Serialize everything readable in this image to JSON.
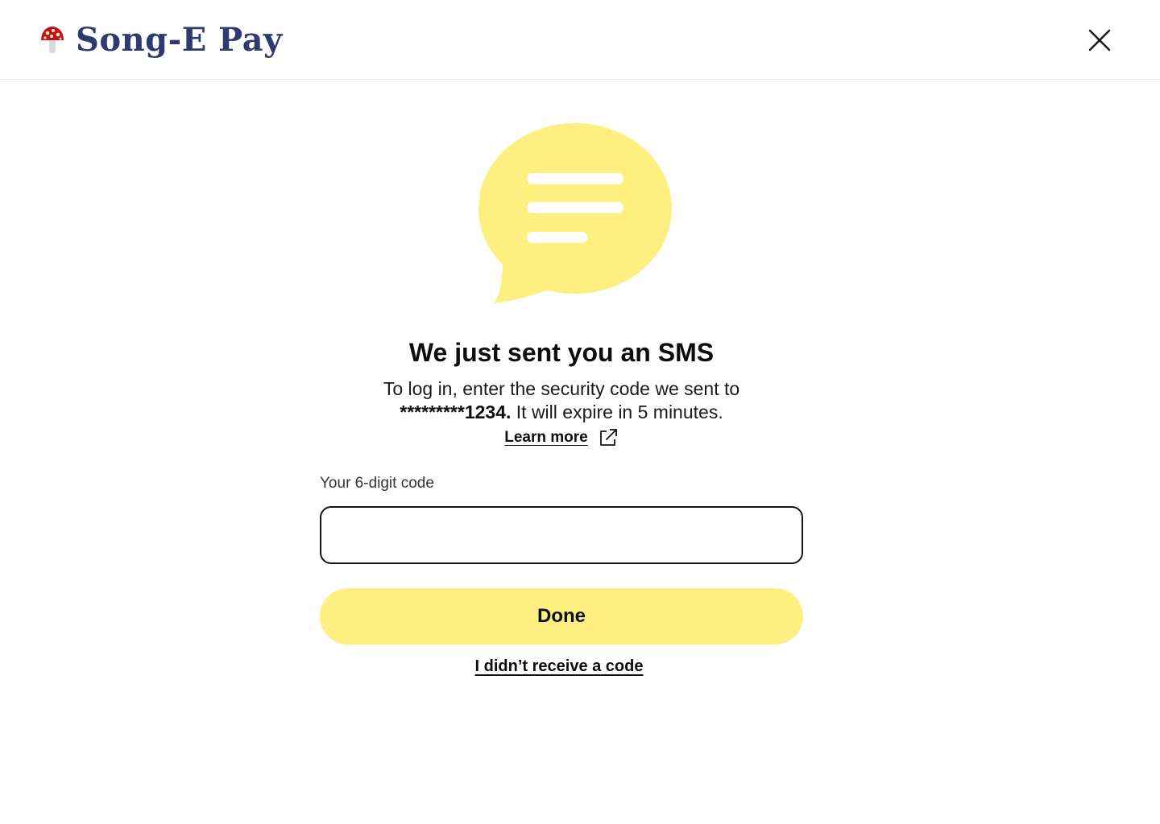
{
  "header": {
    "brand_name": "Song-E Pay",
    "logo_icon": "mushroom-icon",
    "close_icon": "close-icon"
  },
  "main": {
    "illustration_icon": "chat-bubble-icon",
    "title": "We just sent you an SMS",
    "description_prefix": "To log in, enter the security code we sent to",
    "masked_phone": "*********1234.",
    "description_suffix": "It will expire in 5 minutes.",
    "learn_more": "Learn more",
    "learn_more_icon": "external-link-icon",
    "code_label": "Your 6-digit code",
    "code_value": "",
    "code_placeholder": "",
    "done_label": "Done",
    "resend_label": "I didn’t receive a code"
  },
  "colors": {
    "brand": "#2e3a70",
    "accent_yellow": "#fdef80",
    "text": "#0d0d0d"
  }
}
